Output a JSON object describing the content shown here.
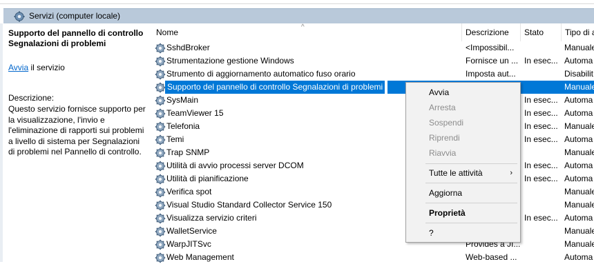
{
  "window": {
    "title": "Servizi (computer locale)"
  },
  "details": {
    "heading": "Supporto del pannello di controllo Segnalazioni di problemi",
    "action_link": "Avvia",
    "action_suffix": " il servizio",
    "description_label": "Descrizione:",
    "description": "Questo servizio fornisce supporto per la visualizzazione, l'invio e l'eliminazione di rapporti sui problemi a livello di sistema per Segnalazioni di problemi nel Pannello di controllo."
  },
  "columns": {
    "name": "Nome",
    "description": "Descrizione",
    "status": "Stato",
    "type": "Tipo di a"
  },
  "rows": [
    {
      "name": "SshdBroker",
      "description": "<Impossibil...",
      "status": "",
      "type": "Manuale"
    },
    {
      "name": "Strumentazione gestione Windows",
      "description": "Fornisce un ...",
      "status": "In esec...",
      "type": "Automa"
    },
    {
      "name": "Strumento di aggiornamento automatico fuso orario",
      "description": "Imposta aut...",
      "status": "",
      "type": "Disabilit"
    },
    {
      "name": "Supporto del pannello di controllo Segnalazioni di problemi",
      "description": "",
      "status": "",
      "type": "Manuale",
      "selected": true
    },
    {
      "name": "SysMain",
      "description": "",
      "status": "In esec...",
      "type": "Automa"
    },
    {
      "name": "TeamViewer 15",
      "description": "",
      "status": "In esec...",
      "type": "Automa"
    },
    {
      "name": "Telefonia",
      "description": "",
      "status": "In esec...",
      "type": "Manuale"
    },
    {
      "name": "Temi",
      "description": "",
      "status": "In esec...",
      "type": "Automa"
    },
    {
      "name": "Trap SNMP",
      "description": "",
      "status": "",
      "type": "Manuale"
    },
    {
      "name": "Utilità di avvio processi server DCOM",
      "description": "",
      "status": "In esec...",
      "type": "Automa"
    },
    {
      "name": "Utilità di pianificazione",
      "description": "",
      "status": "In esec...",
      "type": "Automa"
    },
    {
      "name": "Verifica spot",
      "description": "",
      "status": "",
      "type": "Manuale"
    },
    {
      "name": "Visual Studio Standard Collector Service 150",
      "description": "",
      "status": "",
      "type": "Manuale"
    },
    {
      "name": "Visualizza servizio criteri",
      "description": "",
      "status": "In esec...",
      "type": "Automa"
    },
    {
      "name": "WalletService",
      "description": "",
      "status": "",
      "type": "Manuale"
    },
    {
      "name": "WarpJITSvc",
      "description": "Provides a JI...",
      "status": "",
      "type": "Manuale"
    },
    {
      "name": "Web Management",
      "description": "Web-based ...",
      "status": "",
      "type": "Automa"
    }
  ],
  "context_menu": {
    "start": "Avvia",
    "stop": "Arresta",
    "pause": "Sospendi",
    "resume": "Riprendi",
    "restart": "Riavvia",
    "all_tasks": "Tutte le attività",
    "refresh": "Aggiorna",
    "properties": "Proprietà",
    "help": "?"
  },
  "colors": {
    "selection": "#0078d7",
    "titlebar": "#b9c9da",
    "link": "#0066cc"
  }
}
